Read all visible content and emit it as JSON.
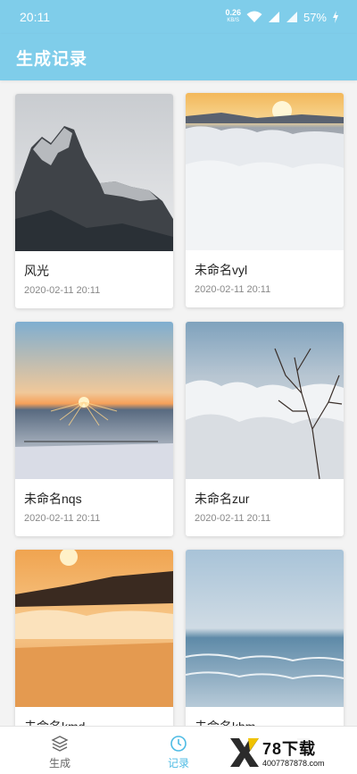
{
  "status_bar": {
    "time": "20:11",
    "net_speed": "0.26",
    "net_speed_unit": "KB/S",
    "battery": "57%",
    "icons": [
      "wifi-icon",
      "signal-icon",
      "signal-icon",
      "battery-charging-icon"
    ]
  },
  "app_bar": {
    "title": "生成记录",
    "background": "#7fcdea"
  },
  "cards": [
    {
      "name": "风光",
      "date": "2020-02-11 20:11",
      "image": "mountain-peaks"
    },
    {
      "name": "未命名vyl",
      "date": "2020-02-11 20:11",
      "image": "sunrise-over-sea-of-clouds"
    },
    {
      "name": "未命名nqs",
      "date": "2020-02-11 20:11",
      "image": "sunrise-over-snowfield"
    },
    {
      "name": "未命名zur",
      "date": "2020-02-11 20:11",
      "image": "tree-over-clouds"
    },
    {
      "name": "未命名kmd",
      "date": "",
      "image": "golden-misty-hills"
    },
    {
      "name": "未命名khm",
      "date": "",
      "image": "ocean-waves"
    }
  ],
  "bottom_nav": {
    "items": [
      {
        "label": "生成",
        "icon": "layers-icon",
        "active": false
      },
      {
        "label": "记录",
        "icon": "clock-icon",
        "active": true
      },
      {
        "label": "",
        "icon": "menu-icon",
        "active": false
      }
    ],
    "active_color": "#4dbbe4"
  },
  "watermark": {
    "brand": "78下载",
    "url": "4007787878.com",
    "logo": "x-logo"
  }
}
